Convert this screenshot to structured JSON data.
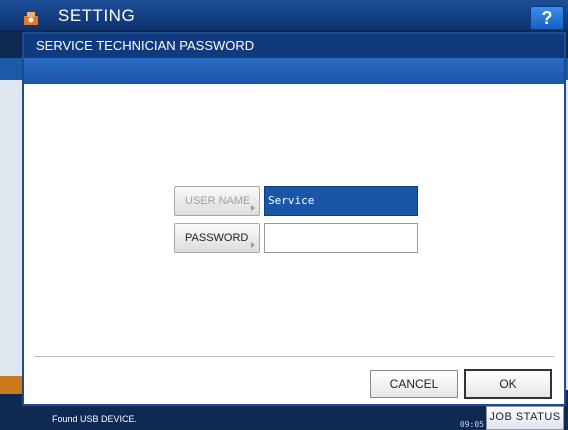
{
  "app": {
    "title": "SETTING",
    "help_label": "?"
  },
  "dialog": {
    "title": "SERVICE TECHNICIAN PASSWORD",
    "username_label": "USER NAME",
    "username_value": "Service",
    "password_label": "PASSWORD",
    "password_value": "",
    "cancel_label": "CANCEL",
    "ok_label": "OK"
  },
  "status": {
    "message": "Found USB DEVICE.",
    "datetime": "09:05",
    "job_status_label": "JOB STATUS"
  },
  "colors": {
    "header_blue": "#0f3b7e",
    "field_filled": "#1a56a8",
    "accent_orange": "#c87a1c"
  }
}
